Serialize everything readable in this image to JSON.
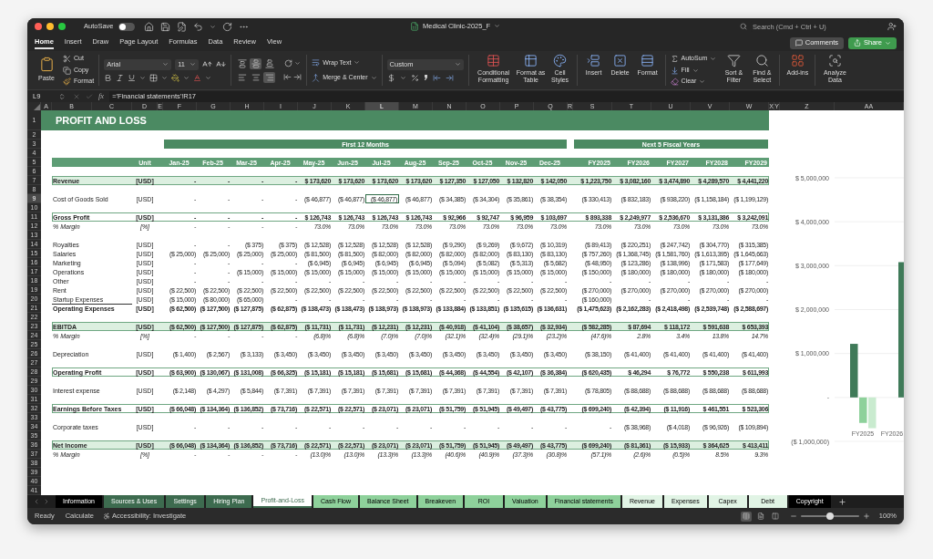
{
  "window": {
    "title": "Medical Clinic-2025_F",
    "autosave": {
      "label": "AutoSave",
      "on": false
    },
    "search": {
      "placeholder": "Search (Cmd + Ctrl + U)"
    }
  },
  "menu_tabs": [
    {
      "label": "Home",
      "selected": true
    },
    {
      "label": "Insert",
      "selected": false
    },
    {
      "label": "Draw",
      "selected": false
    },
    {
      "label": "Page Layout",
      "selected": false
    },
    {
      "label": "Formulas",
      "selected": false
    },
    {
      "label": "Data",
      "selected": false
    },
    {
      "label": "Review",
      "selected": false
    },
    {
      "label": "View",
      "selected": false
    }
  ],
  "actions": {
    "comments": "Comments",
    "share": "Share"
  },
  "ribbon": {
    "paste": "Paste",
    "cut": "Cut",
    "copy": "Copy",
    "format_painter": "Format",
    "font_family": "Arial",
    "font_size": "11",
    "vertical_align": [
      {
        "selected": false
      },
      {
        "selected": true
      },
      {
        "selected": false
      }
    ],
    "horizontal_align": [
      {
        "selected": false
      },
      {
        "selected": false
      },
      {
        "selected": true
      }
    ],
    "wrap_text": "Wrap Text",
    "merge": "Merge & Center",
    "number_format": "Custom",
    "styles": [
      "Conditional Formatting",
      "Format as Table",
      "Cell Styles"
    ],
    "cells": [
      "Insert",
      "Delete",
      "Format"
    ],
    "autosum": "AutoSum",
    "fill": "Fill",
    "clear": "Clear",
    "sort": "Sort & Filter",
    "find": "Find & Select",
    "addins": "Add-ins",
    "analyze": "Analyze Data"
  },
  "formula_bar": {
    "name_box": "L9",
    "function_label": "fx",
    "formula": "='Financial statements'!R17"
  },
  "sheet": {
    "columns": [
      "A",
      "B",
      "C",
      "D",
      "E",
      "F",
      "G",
      "H",
      "I",
      "J",
      "K",
      "L",
      "M",
      "N",
      "O",
      "P",
      "Q",
      "R",
      "S",
      "T",
      "U",
      "V",
      "W",
      "X",
      "Y",
      "Z",
      "AA"
    ],
    "rows": [
      {
        "number": "1",
        "kind": "title",
        "label": "PROFIT AND LOSS"
      },
      {
        "number": "2"
      },
      {
        "number": "3",
        "kind": "groups",
        "groups": [
          "First 12 Months",
          "Next 5 Fiscal Years"
        ]
      },
      {
        "number": "4"
      },
      {
        "number": "5",
        "kind": "header",
        "unit": "Unit",
        "values": [
          "Jan-25",
          "Feb-25",
          "Mar-25",
          "Apr-25",
          "May-25",
          "Jun-25",
          "Jul-25",
          "Aug-25",
          "Sep-25",
          "Oct-25",
          "Nov-25",
          "Dec-25",
          "FY2025",
          "FY2026",
          "FY2027",
          "FY2028",
          "FY2029"
        ]
      },
      {
        "number": "6"
      },
      {
        "number": "7",
        "kind": "band",
        "label": "Revenue",
        "unit": "[USD]",
        "values": [
          "-",
          "-",
          "-",
          "-",
          "$ 173,620",
          "$ 173,620",
          "$ 173,620",
          "$ 173,620",
          "$ 127,350",
          "$ 127,050",
          "$ 132,820",
          "$ 142,050",
          "$ 1,223,750",
          "$ 3,082,160",
          "$ 3,474,890",
          "$ 4,289,570",
          "$ 4,441,220"
        ]
      },
      {
        "number": "8"
      },
      {
        "number": "9",
        "kind": "item",
        "label": "Cost of Goods Sold",
        "unit": "[USD]",
        "values": [
          {
            "text": "-",
            "selected": false
          },
          {
            "text": "-",
            "selected": false
          },
          {
            "text": "-",
            "selected": false
          },
          {
            "text": "-",
            "selected": false
          },
          {
            "text": "($ 46,877)",
            "selected": false
          },
          {
            "text": "($ 46,877)",
            "selected": false
          },
          {
            "text": "($ 46,877)",
            "selected": true
          },
          {
            "text": "($ 46,877)",
            "selected": false
          },
          {
            "text": "($ 34,385)",
            "selected": false
          },
          {
            "text": "($ 34,304)",
            "selected": false
          },
          {
            "text": "($ 35,861)",
            "selected": false
          },
          {
            "text": "($ 38,354)",
            "selected": false
          },
          {
            "text": "($ 330,413)",
            "selected": false
          },
          {
            "text": "($ 832,183)",
            "selected": false
          },
          {
            "text": "($ 938,220)",
            "selected": false
          },
          {
            "text": "($ 1,158,184)",
            "selected": false
          },
          {
            "text": "($ 1,199,129)",
            "selected": false
          }
        ]
      },
      {
        "number": "10"
      },
      {
        "number": "11",
        "kind": "boxed",
        "label": "Gross Profit",
        "unit": "[USD]",
        "values": [
          "-",
          "-",
          "-",
          "-",
          "$ 126,743",
          "$ 126,743",
          "$ 126,743",
          "$ 126,743",
          "$ 92,966",
          "$ 92,747",
          "$ 96,959",
          "$ 103,697",
          "$ 893,338",
          "$ 2,249,977",
          "$ 2,536,670",
          "$ 3,131,386",
          "$ 3,242,091"
        ]
      },
      {
        "number": "12",
        "kind": "margin",
        "label": "% Margin",
        "unit": "[%]",
        "values": [
          "-",
          "-",
          "-",
          "-",
          "73.0%",
          "73.0%",
          "73.0%",
          "73.0%",
          "73.0%",
          "73.0%",
          "73.0%",
          "73.0%",
          "73.0%",
          "73.0%",
          "73.0%",
          "73.0%",
          "73.0%"
        ]
      },
      {
        "number": "13"
      },
      {
        "number": "14",
        "kind": "item",
        "label": "Royalties",
        "unit": "[USD]",
        "values": [
          "-",
          "-",
          "($ 375)",
          "($ 375)",
          "($ 12,528)",
          "($ 12,528)",
          "($ 12,528)",
          "($ 12,528)",
          "($ 9,290)",
          "($ 9,269)",
          "($ 9,672)",
          "($ 10,319)",
          "($ 89,413)",
          "($ 220,251)",
          "($ 247,742)",
          "($ 304,770)",
          "($ 315,385)"
        ]
      },
      {
        "number": "15",
        "kind": "item",
        "label": "Salaries",
        "unit": "[USD]",
        "values": [
          "($ 25,000)",
          "($ 25,000)",
          "($ 25,000)",
          "($ 25,000)",
          "($ 81,500)",
          "($ 81,500)",
          "($ 82,000)",
          "($ 82,000)",
          "($ 82,000)",
          "($ 82,000)",
          "($ 83,130)",
          "($ 83,130)",
          "($ 757,260)",
          "($ 1,368,745)",
          "($ 1,581,760)",
          "($ 1,613,395)",
          "($ 1,645,663)"
        ]
      },
      {
        "number": "16",
        "kind": "item",
        "label": "Marketing",
        "unit": "[USD]",
        "values": [
          "-",
          "-",
          "-",
          "-",
          "($ 6,945)",
          "($ 6,945)",
          "($ 6,945)",
          "($ 6,945)",
          "($ 5,094)",
          "($ 5,082)",
          "($ 5,313)",
          "($ 5,682)",
          "($ 48,950)",
          "($ 123,286)",
          "($ 138,996)",
          "($ 171,583)",
          "($ 177,649)"
        ]
      },
      {
        "number": "17",
        "kind": "item",
        "label": "Operations",
        "unit": "[USD]",
        "values": [
          "-",
          "-",
          "($ 15,000)",
          "($ 15,000)",
          "($ 15,000)",
          "($ 15,000)",
          "($ 15,000)",
          "($ 15,000)",
          "($ 15,000)",
          "($ 15,000)",
          "($ 15,000)",
          "($ 15,000)",
          "($ 150,000)",
          "($ 180,000)",
          "($ 180,000)",
          "($ 180,000)",
          "($ 180,000)"
        ]
      },
      {
        "number": "18",
        "kind": "item",
        "label": "Other",
        "unit": "[USD]",
        "values": [
          "-",
          "-",
          "-",
          "-",
          "-",
          "-",
          "-",
          "-",
          "-",
          "-",
          "-",
          "-",
          "-",
          "-",
          "-",
          "-",
          "-"
        ]
      },
      {
        "number": "19",
        "kind": "item",
        "label": "Rent",
        "unit": "[USD]",
        "values": [
          "($ 22,500)",
          "($ 22,500)",
          "($ 22,500)",
          "($ 22,500)",
          "($ 22,500)",
          "($ 22,500)",
          "($ 22,500)",
          "($ 22,500)",
          "($ 22,500)",
          "($ 22,500)",
          "($ 22,500)",
          "($ 22,500)",
          "($ 270,000)",
          "($ 270,000)",
          "($ 270,000)",
          "($ 270,000)",
          "($ 270,000)"
        ]
      },
      {
        "number": "20",
        "kind": "item",
        "label": "Startup Expenses",
        "unit": "[USD]",
        "values": [
          "($ 15,000)",
          "($ 80,000)",
          "($ 65,000)",
          "-",
          "-",
          "-",
          "-",
          "-",
          "-",
          "-",
          "-",
          "-",
          "($ 160,000)",
          "-",
          "-",
          "-",
          "-"
        ]
      },
      {
        "number": "21",
        "kind": "total",
        "label": "Operating Expenses",
        "unit": "[USD]",
        "values": [
          "($ 62,500)",
          "($ 127,500)",
          "($ 127,875)",
          "($ 62,875)",
          "($ 138,473)",
          "($ 138,473)",
          "($ 138,973)",
          "($ 138,973)",
          "($ 133,884)",
          "($ 133,851)",
          "($ 135,615)",
          "($ 136,631)",
          "($ 1,475,623)",
          "($ 2,162,283)",
          "($ 2,418,498)",
          "($ 2,539,748)",
          "($ 2,588,697)"
        ]
      },
      {
        "number": "22"
      },
      {
        "number": "23",
        "kind": "band",
        "label": "EBITDA",
        "unit": "[USD]",
        "values": [
          "($ 62,500)",
          "($ 127,500)",
          "($ 127,875)",
          "($ 62,875)",
          "($ 11,731)",
          "($ 11,731)",
          "($ 12,231)",
          "($ 12,231)",
          "($ 40,918)",
          "($ 41,104)",
          "($ 38,657)",
          "($ 32,934)",
          "($ 582,285)",
          "$ 87,694",
          "$ 118,172",
          "$ 591,638",
          "$ 653,393"
        ]
      },
      {
        "number": "24",
        "kind": "margin",
        "label": "% Margin",
        "unit": "[%]",
        "values": [
          "-",
          "-",
          "-",
          "-",
          "(6.8)%",
          "(6.8)%",
          "(7.0)%",
          "(7.0)%",
          "(32.1)%",
          "(32.4)%",
          "(29.1)%",
          "(23.2)%",
          "(47.6)%",
          "2.8%",
          "3.4%",
          "13.8%",
          "14.7%"
        ]
      },
      {
        "number": "25"
      },
      {
        "number": "26",
        "kind": "item",
        "label": "Depreciation",
        "unit": "[USD]",
        "values": [
          "($ 1,400)",
          "($ 2,567)",
          "($ 3,133)",
          "($ 3,450)",
          "($ 3,450)",
          "($ 3,450)",
          "($ 3,450)",
          "($ 3,450)",
          "($ 3,450)",
          "($ 3,450)",
          "($ 3,450)",
          "($ 3,450)",
          "($ 38,150)",
          "($ 41,400)",
          "($ 41,400)",
          "($ 41,400)",
          "($ 41,400)"
        ]
      },
      {
        "number": "27"
      },
      {
        "number": "28",
        "kind": "boxed",
        "label": "Operating Profit",
        "unit": "[USD]",
        "values": [
          "($ 63,900)",
          "($ 130,067)",
          "($ 131,008)",
          "($ 66,325)",
          "($ 15,181)",
          "($ 15,181)",
          "($ 15,681)",
          "($ 15,681)",
          "($ 44,368)",
          "($ 44,554)",
          "($ 42,107)",
          "($ 36,384)",
          "($ 620,435)",
          "$ 46,294",
          "$ 76,772",
          "$ 550,238",
          "$ 611,993"
        ]
      },
      {
        "number": "29"
      },
      {
        "number": "30",
        "kind": "item",
        "label": "Interest expense",
        "unit": "[USD]",
        "values": [
          "($ 2,148)",
          "($ 4,297)",
          "($ 5,844)",
          "($ 7,391)",
          "($ 7,391)",
          "($ 7,391)",
          "($ 7,391)",
          "($ 7,391)",
          "($ 7,391)",
          "($ 7,391)",
          "($ 7,391)",
          "($ 7,391)",
          "($ 78,805)",
          "($ 88,688)",
          "($ 88,688)",
          "($ 88,688)",
          "($ 88,688)"
        ]
      },
      {
        "number": "31"
      },
      {
        "number": "32",
        "kind": "boxed",
        "label": "Earnings Before Taxes",
        "unit": "[USD]",
        "values": [
          "($ 66,048)",
          "($ 134,364)",
          "($ 136,852)",
          "($ 73,716)",
          "($ 22,571)",
          "($ 22,571)",
          "($ 23,071)",
          "($ 23,071)",
          "($ 51,759)",
          "($ 51,945)",
          "($ 49,497)",
          "($ 43,775)",
          "($ 699,240)",
          "($ 42,394)",
          "($ 11,916)",
          "$ 461,551",
          "$ 523,306"
        ]
      },
      {
        "number": "33"
      },
      {
        "number": "34",
        "kind": "item",
        "label": "Corporate taxes",
        "unit": "[USD]",
        "values": [
          "-",
          "-",
          "-",
          "-",
          "-",
          "-",
          "-",
          "-",
          "-",
          "-",
          "-",
          "-",
          "-",
          "($ 38,968)",
          "($ 4,018)",
          "($ 96,926)",
          "($ 109,894)"
        ]
      },
      {
        "number": "35"
      },
      {
        "number": "36",
        "kind": "band",
        "label": "Net Income",
        "unit": "[USD]",
        "values": [
          "($ 66,048)",
          "($ 134,364)",
          "($ 136,852)",
          "($ 73,716)",
          "($ 22,571)",
          "($ 22,571)",
          "($ 23,071)",
          "($ 23,071)",
          "($ 51,759)",
          "($ 51,945)",
          "($ 49,497)",
          "($ 43,775)",
          "($ 699,240)",
          "($ 81,361)",
          "($ 15,933)",
          "$ 364,625",
          "$ 413,411"
        ]
      },
      {
        "number": "37",
        "kind": "margin",
        "label": "% Margin",
        "unit": "[%]",
        "values": [
          "-",
          "-",
          "-",
          "-",
          "(13.0)%",
          "(13.0)%",
          "(13.3)%",
          "(13.3)%",
          "(40.6)%",
          "(40.9)%",
          "(37.3)%",
          "(30.8)%",
          "(57.1)%",
          "(2.6)%",
          "(0.5)%",
          "8.5%",
          "9.3%"
        ]
      },
      {
        "number": "38"
      },
      {
        "number": "39"
      },
      {
        "number": "40"
      },
      {
        "number": "41"
      }
    ],
    "chart": {
      "chart_data": {
        "type": "bar",
        "grid": true,
        "categories": [
          "FY2025",
          "FY2026"
        ],
        "series": [
          {
            "color": "#3f7a58",
            "values": [
              1220000,
              3080000
            ]
          },
          {
            "color": "#8ed19b",
            "values": [
              -580000,
              null
            ]
          },
          {
            "color": "#c9ebcf",
            "values": [
              -700000,
              null
            ]
          }
        ],
        "ylim": [
          -1000000,
          5000000
        ],
        "yticks": [
          {
            "value": 5000000,
            "label": "$ 5,000,000"
          },
          {
            "value": 4000000,
            "label": "$ 4,000,000"
          },
          {
            "value": 3000000,
            "label": "$ 3,000,000"
          },
          {
            "value": 2000000,
            "label": "$ 2,000,000"
          },
          {
            "value": 1000000,
            "label": "$ 1,000,000"
          },
          {
            "value": 0,
            "label": "-"
          },
          {
            "value": -1000000,
            "label": "($ 1,000,000)"
          }
        ]
      }
    }
  },
  "sheet_tabs": [
    {
      "label": "Information",
      "selected": false,
      "color": "#000000"
    },
    {
      "label": "Sources & Uses",
      "selected": false,
      "color": "#3d6b4f"
    },
    {
      "label": "Settings",
      "selected": false,
      "color": "#3d6b4f"
    },
    {
      "label": "Hiring Plan",
      "selected": false,
      "color": "#3d6b4f"
    },
    {
      "label": "Profit-and-Loss",
      "selected": true,
      "color": "#3d6b4f"
    },
    {
      "label": "Cash Flow",
      "selected": false,
      "color": "#8ed19b"
    },
    {
      "label": "Balance Sheet",
      "selected": false,
      "color": "#8ed19b"
    },
    {
      "label": "Breakeven",
      "selected": false,
      "color": "#8ed19b"
    },
    {
      "label": "ROI",
      "selected": false,
      "color": "#8ed19b"
    },
    {
      "label": "Valuation",
      "selected": false,
      "color": "#8ed19b"
    },
    {
      "label": "Financial statements",
      "selected": false,
      "color": "#8ed19b"
    },
    {
      "label": "Revenue",
      "selected": false,
      "color": "#e1f4e5"
    },
    {
      "label": "Expenses",
      "selected": false,
      "color": "#e1f4e5"
    },
    {
      "label": "Capex",
      "selected": false,
      "color": "#e1f4e5"
    },
    {
      "label": "Debt",
      "selected": false,
      "color": "#e1f4e5"
    },
    {
      "label": "Copyright",
      "selected": false,
      "color": "#000000"
    }
  ],
  "status_bar": {
    "status": "Ready",
    "calculate": "Calculate",
    "accessibility": "Accessibility: Investigate",
    "views": [
      {
        "selected": true
      },
      {
        "selected": false
      },
      {
        "selected": false
      }
    ],
    "zoom": {
      "level": 0.5,
      "reading": "100%"
    }
  }
}
